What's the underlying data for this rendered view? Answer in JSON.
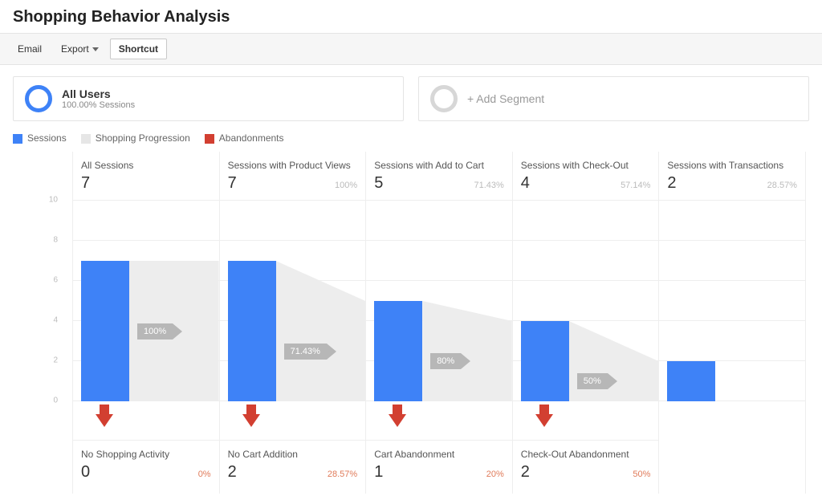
{
  "title": "Shopping Behavior Analysis",
  "toolbar": {
    "email": "Email",
    "export": "Export",
    "shortcut": "Shortcut"
  },
  "segments": {
    "all_users_title": "All Users",
    "all_users_sub": "100.00% Sessions",
    "add_segment": "+ Add Segment"
  },
  "legend": {
    "sessions": "Sessions",
    "progression": "Shopping Progression",
    "abandon": "Abandonments"
  },
  "axis": {
    "ticks": [
      "0",
      "2",
      "4",
      "6",
      "8",
      "10"
    ],
    "max": 10
  },
  "steps": [
    {
      "label": "All Sessions",
      "value": 7,
      "pct": "",
      "flow_pct": "100%",
      "drop_label": "No Shopping Activity",
      "drop_value": 0,
      "drop_pct": "0%"
    },
    {
      "label": "Sessions with Product Views",
      "value": 7,
      "pct": "100%",
      "flow_pct": "71.43%",
      "drop_label": "No Cart Addition",
      "drop_value": 2,
      "drop_pct": "28.57%"
    },
    {
      "label": "Sessions with Add to Cart",
      "value": 5,
      "pct": "71.43%",
      "flow_pct": "80%",
      "drop_label": "Cart Abandonment",
      "drop_value": 1,
      "drop_pct": "20%"
    },
    {
      "label": "Sessions with Check-Out",
      "value": 4,
      "pct": "57.14%",
      "flow_pct": "50%",
      "drop_label": "Check-Out Abandonment",
      "drop_value": 2,
      "drop_pct": "50%"
    },
    {
      "label": "Sessions with Transactions",
      "value": 2,
      "pct": "28.57%"
    }
  ],
  "chart_data": {
    "type": "bar",
    "title": "Shopping Behavior Analysis",
    "categories": [
      "All Sessions",
      "Sessions with Product Views",
      "Sessions with Add to Cart",
      "Sessions with Check-Out",
      "Sessions with Transactions"
    ],
    "series": [
      {
        "name": "Sessions",
        "values": [
          7,
          7,
          5,
          4,
          2
        ]
      },
      {
        "name": "Abandonments",
        "values": [
          0,
          2,
          1,
          2,
          null
        ],
        "labels": [
          "No Shopping Activity",
          "No Cart Addition",
          "Cart Abandonment",
          "Check-Out Abandonment",
          null
        ]
      }
    ],
    "progression_pct": [
      100,
      71.43,
      80,
      50
    ],
    "step_pct_of_total": [
      null,
      100,
      71.43,
      57.14,
      28.57
    ],
    "abandon_pct": [
      0,
      28.57,
      20,
      50
    ],
    "ylabel": "",
    "xlabel": "",
    "ylim": [
      0,
      10
    ]
  }
}
